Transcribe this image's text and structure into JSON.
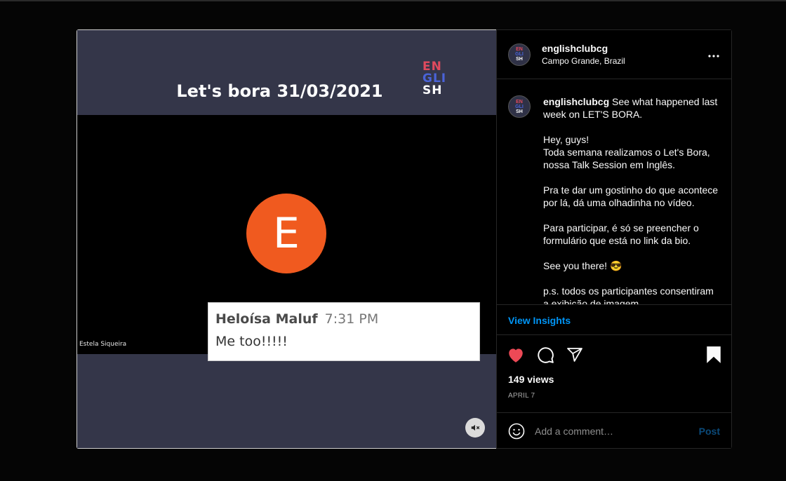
{
  "post": {
    "username": "englishclubcg",
    "location": "Campo Grande, Brazil",
    "avatar_letters": [
      "EN",
      "GLI",
      "SH"
    ],
    "more_icon": "more-horizontal-icon"
  },
  "video": {
    "title": "Let's bora 31/03/2021",
    "logo_lines": [
      "EN",
      "GLI",
      "SH"
    ],
    "avatar_letter": "E",
    "participant_name": "Estela Siqueira",
    "chat": {
      "author": "Heloísa Maluf",
      "time": "7:31 PM",
      "message": "Me too!!!!!"
    },
    "mute_icon": "volume-muted-icon"
  },
  "caption": {
    "username": "englishclubcg",
    "first_line": "See what happened last week on LET'S BORA.",
    "paragraphs": [
      "Hey, guys!\nToda semana realizamos o Let's Bora, nossa Talk Session em Inglês.",
      "Pra te dar um gostinho do que acontece por lá, dá uma olhadinha no vídeo.",
      "Para participar, é só se preencher o formulário que está no link da bio.",
      "See you there! 😎",
      "p.s. todos os participantes consentiram a exibição de imagem"
    ]
  },
  "insights_label": "View Insights",
  "actions": {
    "like_icon": "heart-filled-icon",
    "comment_icon": "comment-icon",
    "share_icon": "share-icon",
    "save_icon": "bookmark-filled-icon",
    "like_color": "#ed4956"
  },
  "stats": {
    "views": "149 views",
    "date": "APRIL 7"
  },
  "comment": {
    "emoji_icon": "emoji-icon",
    "placeholder": "Add a comment…",
    "post_label": "Post"
  }
}
